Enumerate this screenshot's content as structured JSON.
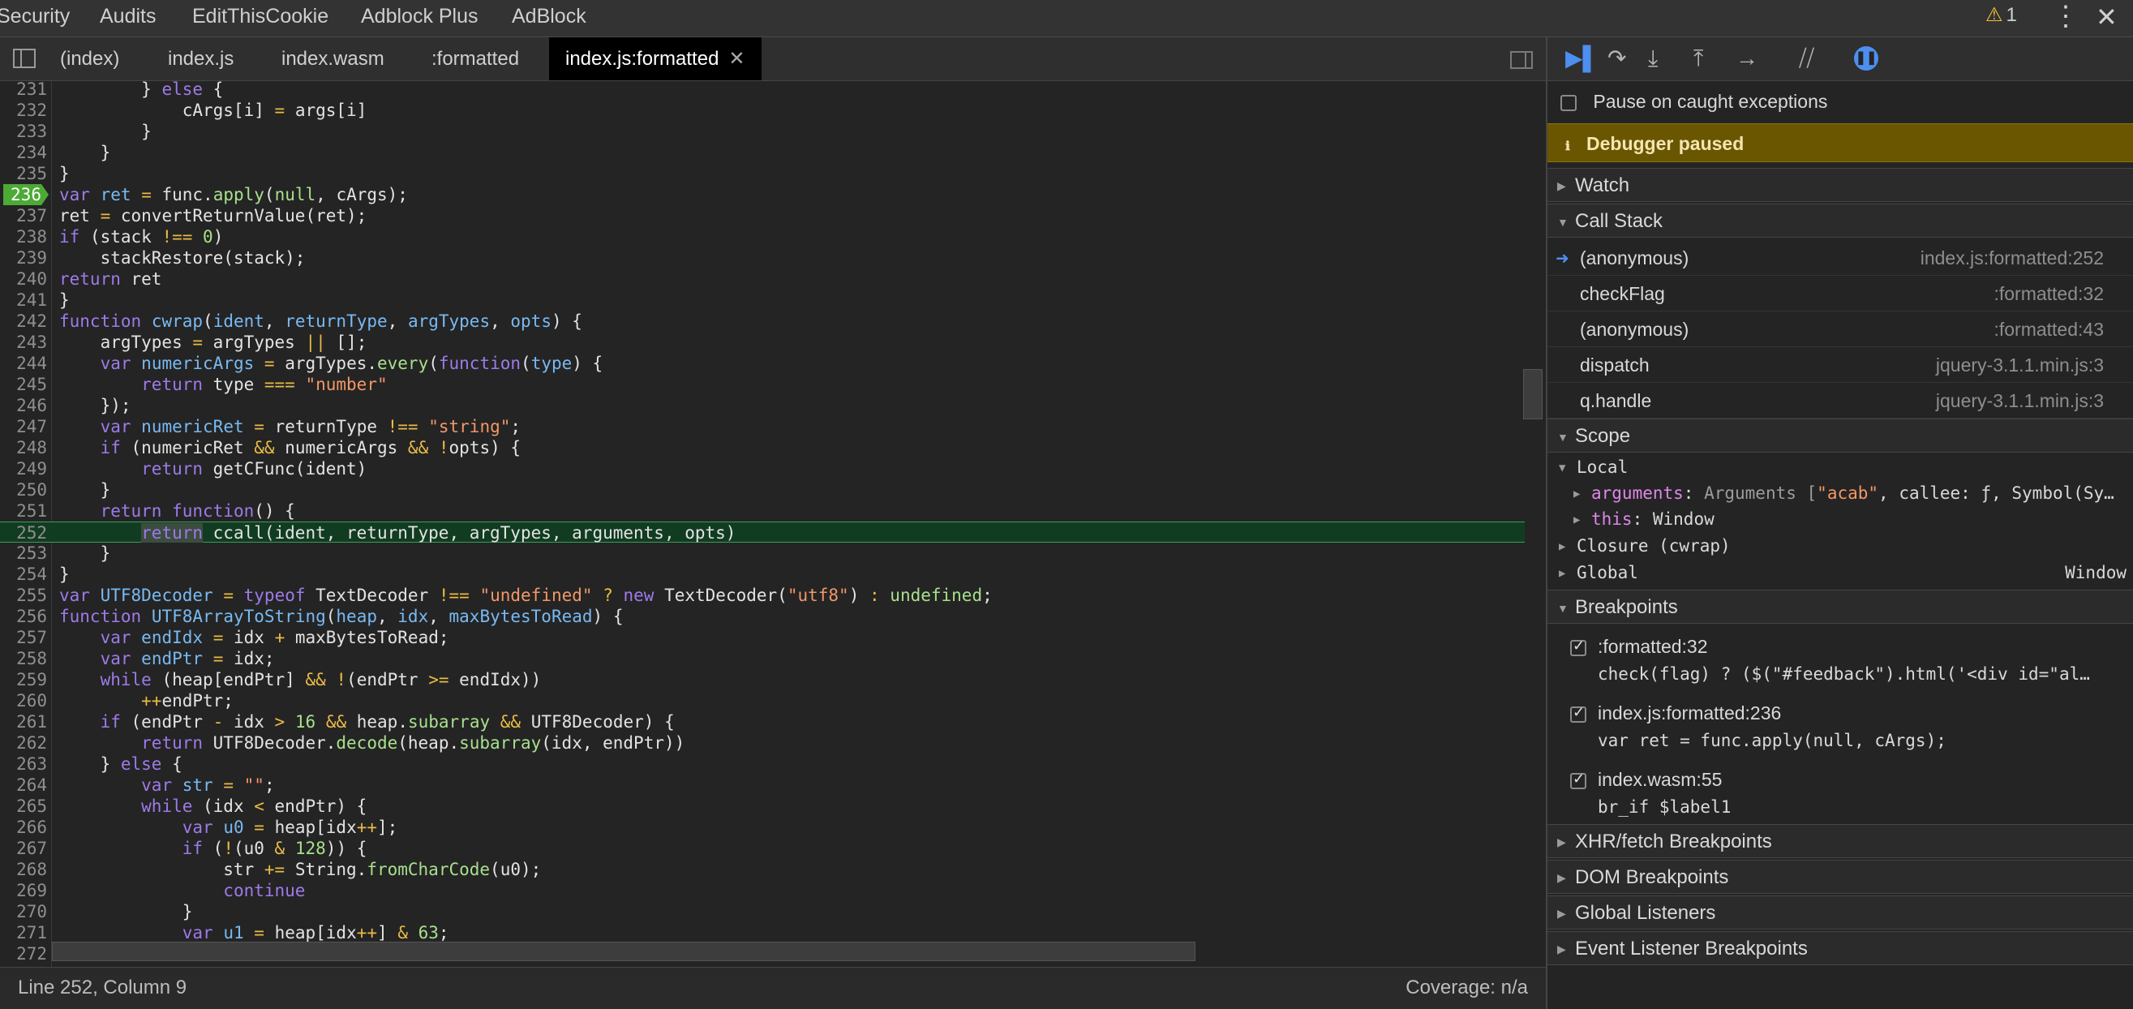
{
  "top_tabs": [
    "Security",
    "Audits",
    "EditThisCookie",
    "Adblock Plus",
    "AdBlock"
  ],
  "warning_count": "1",
  "file_tabs": [
    "(index)",
    "index.js",
    "index.wasm",
    ":formatted",
    "index.js:formatted"
  ],
  "code": [
    {
      "n": "231",
      "h": "        } <span class=\"kw\">else</span> {"
    },
    {
      "n": "232",
      "h": "            cArgs[i] <span class=\"op\">=</span> args[i]"
    },
    {
      "n": "233",
      "h": "        }"
    },
    {
      "n": "234",
      "h": "    }"
    },
    {
      "n": "235",
      "h": "}"
    },
    {
      "n": "236",
      "h": "<span class=\"kw\">var</span> <span class=\"id\">ret</span> <span class=\"op\">=</span> func.<span class=\"nm\">apply</span>(<span class=\"nm\">null</span>, cArgs);",
      "bp": true
    },
    {
      "n": "237",
      "h": "ret <span class=\"op\">=</span> convertReturnValue(ret);"
    },
    {
      "n": "238",
      "h": "<span class=\"kw\">if</span> (stack <span class=\"op\">!==</span> <span class=\"nm\">0</span>)"
    },
    {
      "n": "239",
      "h": "    stackRestore(stack);"
    },
    {
      "n": "240",
      "h": "<span class=\"kw\">return</span> ret"
    },
    {
      "n": "241",
      "h": "}"
    },
    {
      "n": "242",
      "h": "<span class=\"kw\">function</span> <span class=\"id\">cwrap</span>(<span class=\"id\">ident</span>, <span class=\"id\">returnType</span>, <span class=\"id\">argTypes</span>, <span class=\"id\">opts</span>) {"
    },
    {
      "n": "243",
      "h": "    argTypes <span class=\"op\">=</span> argTypes <span class=\"op\">||</span> [];"
    },
    {
      "n": "244",
      "h": "    <span class=\"kw\">var</span> <span class=\"id\">numericArgs</span> <span class=\"op\">=</span> argTypes.<span class=\"nm\">every</span>(<span class=\"kw\">function</span>(<span class=\"id\">type</span>) {"
    },
    {
      "n": "245",
      "h": "        <span class=\"kw\">return</span> type <span class=\"op\">===</span> <span class=\"st\">\"number\"</span>"
    },
    {
      "n": "246",
      "h": "    });"
    },
    {
      "n": "247",
      "h": "    <span class=\"kw\">var</span> <span class=\"id\">numericRet</span> <span class=\"op\">=</span> returnType <span class=\"op\">!==</span> <span class=\"st\">\"string\"</span>;"
    },
    {
      "n": "248",
      "h": "    <span class=\"kw\">if</span> (numericRet <span class=\"op\">&amp;&amp;</span> numericArgs <span class=\"op\">&amp;&amp;</span> <span class=\"op\">!</span>opts) {"
    },
    {
      "n": "249",
      "h": "        <span class=\"kw\">return</span> getCFunc(ident)"
    },
    {
      "n": "250",
      "h": "    }"
    },
    {
      "n": "251",
      "h": "    <span class=\"kw\">return</span> <span class=\"kw\">function</span>() {"
    },
    {
      "n": "252",
      "h": "        <span class=\"kw retk\">return</span> ccall(ident, returnType, argTypes, arguments, opts)",
      "cur": true
    },
    {
      "n": "253",
      "h": "    }"
    },
    {
      "n": "254",
      "h": "}"
    },
    {
      "n": "255",
      "h": "<span class=\"kw\">var</span> <span class=\"id\">UTF8Decoder</span> <span class=\"op\">=</span> <span class=\"kw\">typeof</span> TextDecoder <span class=\"op\">!==</span> <span class=\"st\">\"undefined\"</span> <span class=\"op\">?</span> <span class=\"kw\">new</span> TextDecoder(<span class=\"st\">\"utf8\"</span>) <span class=\"op\">:</span> <span class=\"nm\">undefined</span>;"
    },
    {
      "n": "256",
      "h": "<span class=\"kw\">function</span> <span class=\"id\">UTF8ArrayToString</span>(<span class=\"id\">heap</span>, <span class=\"id\">idx</span>, <span class=\"id\">maxBytesToRead</span>) {"
    },
    {
      "n": "257",
      "h": "    <span class=\"kw\">var</span> <span class=\"id\">endIdx</span> <span class=\"op\">=</span> idx <span class=\"op\">+</span> maxBytesToRead;"
    },
    {
      "n": "258",
      "h": "    <span class=\"kw\">var</span> <span class=\"id\">endPtr</span> <span class=\"op\">=</span> idx;"
    },
    {
      "n": "259",
      "h": "    <span class=\"kw\">while</span> (heap[endPtr] <span class=\"op\">&amp;&amp;</span> <span class=\"op\">!</span>(endPtr <span class=\"op\">&gt;=</span> endIdx))"
    },
    {
      "n": "260",
      "h": "        <span class=\"op\">++</span>endPtr;"
    },
    {
      "n": "261",
      "h": "    <span class=\"kw\">if</span> (endPtr <span class=\"op\">-</span> idx <span class=\"op\">&gt;</span> <span class=\"nm\">16</span> <span class=\"op\">&amp;&amp;</span> heap.<span class=\"nm\">subarray</span> <span class=\"op\">&amp;&amp;</span> UTF8Decoder) {"
    },
    {
      "n": "262",
      "h": "        <span class=\"kw\">return</span> UTF8Decoder.<span class=\"nm\">decode</span>(heap.<span class=\"nm\">subarray</span>(idx, endPtr))"
    },
    {
      "n": "263",
      "h": "    } <span class=\"kw\">else</span> {"
    },
    {
      "n": "264",
      "h": "        <span class=\"kw\">var</span> <span class=\"id\">str</span> <span class=\"op\">=</span> <span class=\"st\">\"\"</span>;"
    },
    {
      "n": "265",
      "h": "        <span class=\"kw\">while</span> (idx <span class=\"op\">&lt;</span> endPtr) {"
    },
    {
      "n": "266",
      "h": "            <span class=\"kw\">var</span> <span class=\"id\">u0</span> <span class=\"op\">=</span> heap[idx<span class=\"op\">++</span>];"
    },
    {
      "n": "267",
      "h": "            <span class=\"kw\">if</span> (<span class=\"op\">!</span>(u0 <span class=\"op\">&amp;</span> <span class=\"nm\">128</span>)) {"
    },
    {
      "n": "268",
      "h": "                str <span class=\"op\">+=</span> String.<span class=\"nm\">fromCharCode</span>(u0);"
    },
    {
      "n": "269",
      "h": "                <span class=\"kw\">continue</span>"
    },
    {
      "n": "270",
      "h": "            }"
    },
    {
      "n": "271",
      "h": "            <span class=\"kw\">var</span> <span class=\"id\">u1</span> <span class=\"op\">=</span> heap[idx<span class=\"op\">++</span>] <span class=\"op\">&amp;</span> <span class=\"nm\">63</span>;"
    },
    {
      "n": "272",
      "h": ""
    }
  ],
  "status": {
    "position": "Line 252, Column 9",
    "coverage": "Coverage: n/a"
  },
  "debugger": {
    "pause_on_caught": "Pause on caught exceptions",
    "paused_banner": "Debugger paused",
    "watch": "Watch",
    "call_stack_title": "Call Stack",
    "call_stack": [
      {
        "name": "(anonymous)",
        "loc": "index.js:formatted:252"
      },
      {
        "name": "checkFlag",
        "loc": ":formatted:32"
      },
      {
        "name": "(anonymous)",
        "loc": ":formatted:43"
      },
      {
        "name": "dispatch",
        "loc": "jquery-3.1.1.min.js:3"
      },
      {
        "name": "q.handle",
        "loc": "jquery-3.1.1.min.js:3"
      }
    ],
    "scope_title": "Scope",
    "scope_local": "Local",
    "scope_arguments_key": "arguments",
    "scope_arguments_val_pre": "Arguments [",
    "scope_arguments_str": "\"acab\"",
    "scope_arguments_val_post": ", callee: ƒ, Symbol(Sy…",
    "scope_this_key": "this",
    "scope_this_val": "Window",
    "scope_closure": "Closure (cwrap)",
    "scope_global": "Global",
    "scope_global_val": "Window",
    "breakpoints_title": "Breakpoints",
    "breakpoints": [
      {
        "loc": ":formatted:32",
        "code": "check(flag) ? ($(\"#feedback\").html('<div id=\"al…"
      },
      {
        "loc": "index.js:formatted:236",
        "code": "var ret = func.apply(null, cArgs);"
      },
      {
        "loc": "index.wasm:55",
        "code": "br_if $label1"
      }
    ],
    "xhr": "XHR/fetch Breakpoints",
    "dom": "DOM Breakpoints",
    "global_listeners": "Global Listeners",
    "event_listeners": "Event Listener Breakpoints"
  }
}
